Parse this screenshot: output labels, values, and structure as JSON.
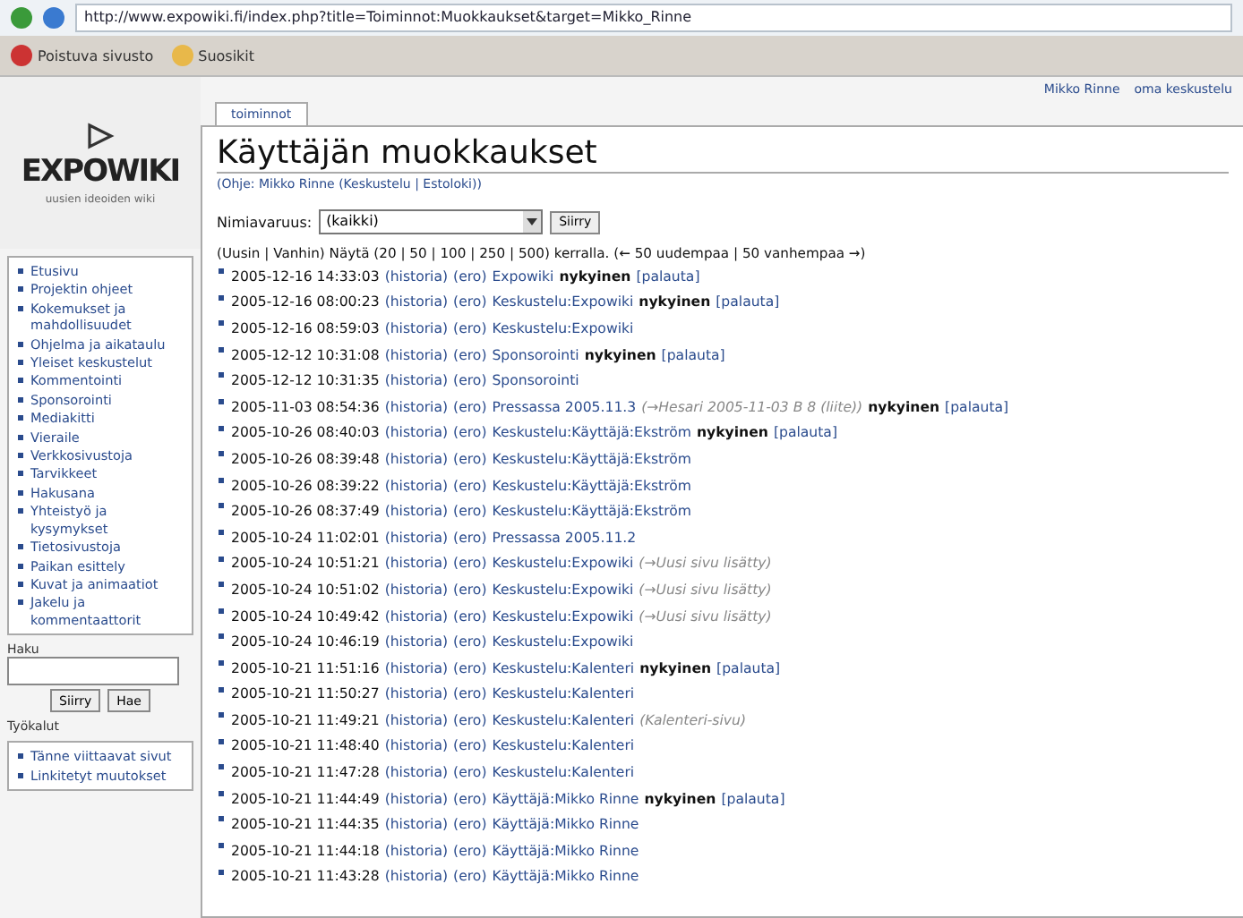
{
  "browser": {
    "url": "http://www.expowiki.fi/index.php?title=Toiminnot:Muokkaukset&target=Mikko_Rinne",
    "bookmarks": [
      "Poistuva sivusto",
      "Suosikit"
    ]
  },
  "user_links": [
    "Mikko Rinne",
    "oma keskustelu"
  ],
  "logo": {
    "name": "EXPOWIKI",
    "tagline": "uusien ideoiden wiki"
  },
  "sidebar": {
    "items": [
      "Etusivu",
      "Projektin ohjeet",
      "Kokemukset ja mahdollisuudet",
      "Ohjelma ja aikataulu",
      "Yleiset keskustelut",
      "Kommentointi",
      "Sponsorointi",
      "Mediakitti",
      "Vieraile",
      "Verkkosivustoja",
      "Tarvikkeet",
      "Hakusana",
      "Yhteistyö ja kysymykset",
      "Tietosivustoja",
      "Paikan esittely",
      "Kuvat ja animaatiot",
      "Jakelu ja kommentaattorit"
    ]
  },
  "search": {
    "heading": "Haku",
    "buttons": [
      "Siirry",
      "Hae"
    ]
  },
  "tools": {
    "heading": "Työkalut",
    "items": [
      "Tänne viittaavat sivut",
      "Linkitetyt muutokset"
    ]
  },
  "tab": "toiminnot",
  "title": "Käyttäjän muokkaukset",
  "subtitle": "(Ohje: Mikko Rinne (Keskustelu | Estoloki))",
  "filter": {
    "label": "Nimiavaruus:",
    "value": "(kaikki)",
    "button": "Siirry"
  },
  "nav": "(Uusin | Vanhin) Näytä (20 | 50 | 100 | 250 | 500) kerralla. (← 50 uudempaa | 50 vanhempaa →)",
  "rows": [
    {
      "time": "2005-12-16 14:33:03",
      "hist": "(historia)",
      "diff": "(ero)",
      "title": "Expowiki",
      "top": "nykyinen",
      "rollback": "[palauta]"
    },
    {
      "time": "2005-12-16 08:00:23",
      "hist": "(historia)",
      "diff": "(ero)",
      "title": "Keskustelu:Expowiki",
      "top": "nykyinen",
      "rollback": "[palauta]"
    },
    {
      "time": "2005-12-16 08:59:03",
      "hist": "(historia)",
      "diff": "(ero)",
      "title": "Keskustelu:Expowiki"
    },
    {
      "time": "2005-12-12 10:31:08",
      "hist": "(historia)",
      "diff": "(ero)",
      "title": "Sponsorointi",
      "top": "nykyinen",
      "rollback": "[palauta]"
    },
    {
      "time": "2005-12-12 10:31:35",
      "hist": "(historia)",
      "diff": "(ero)",
      "title": "Sponsorointi"
    },
    {
      "time": "2005-11-03 08:54:36",
      "hist": "(historia)",
      "diff": "(ero)",
      "title": "Pressassa 2005.11.3",
      "comment": "(→Hesari 2005-11-03 B 8 (liite))",
      "top": "nykyinen",
      "rollback": "[palauta]"
    },
    {
      "time": "2005-10-26 08:40:03",
      "hist": "(historia)",
      "diff": "(ero)",
      "title": "Keskustelu:Käyttäjä:Ekström",
      "top": "nykyinen",
      "rollback": "[palauta]"
    },
    {
      "time": "2005-10-26 08:39:48",
      "hist": "(historia)",
      "diff": "(ero)",
      "title": "Keskustelu:Käyttäjä:Ekström"
    },
    {
      "time": "2005-10-26 08:39:22",
      "hist": "(historia)",
      "diff": "(ero)",
      "title": "Keskustelu:Käyttäjä:Ekström"
    },
    {
      "time": "2005-10-26 08:37:49",
      "hist": "(historia)",
      "diff": "(ero)",
      "title": "Keskustelu:Käyttäjä:Ekström"
    },
    {
      "time": "2005-10-24 11:02:01",
      "hist": "(historia)",
      "diff": "(ero)",
      "title": "Pressassa 2005.11.2"
    },
    {
      "time": "2005-10-24 10:51:21",
      "hist": "(historia)",
      "diff": "(ero)",
      "title": "Keskustelu:Expowiki",
      "comment": "(→Uusi sivu lisätty)"
    },
    {
      "time": "2005-10-24 10:51:02",
      "hist": "(historia)",
      "diff": "(ero)",
      "title": "Keskustelu:Expowiki",
      "comment": "(→Uusi sivu lisätty)"
    },
    {
      "time": "2005-10-24 10:49:42",
      "hist": "(historia)",
      "diff": "(ero)",
      "title": "Keskustelu:Expowiki",
      "comment": "(→Uusi sivu lisätty)"
    },
    {
      "time": "2005-10-24 10:46:19",
      "hist": "(historia)",
      "diff": "(ero)",
      "title": "Keskustelu:Expowiki"
    },
    {
      "time": "2005-10-21 11:51:16",
      "hist": "(historia)",
      "diff": "(ero)",
      "title": "Keskustelu:Kalenteri",
      "top": "nykyinen",
      "rollback": "[palauta]"
    },
    {
      "time": "2005-10-21 11:50:27",
      "hist": "(historia)",
      "diff": "(ero)",
      "title": "Keskustelu:Kalenteri"
    },
    {
      "time": "2005-10-21 11:49:21",
      "hist": "(historia)",
      "diff": "(ero)",
      "title": "Keskustelu:Kalenteri",
      "comment": "(Kalenteri-sivu)"
    },
    {
      "time": "2005-10-21 11:48:40",
      "hist": "(historia)",
      "diff": "(ero)",
      "title": "Keskustelu:Kalenteri"
    },
    {
      "time": "2005-10-21 11:47:28",
      "hist": "(historia)",
      "diff": "(ero)",
      "title": "Keskustelu:Kalenteri"
    },
    {
      "time": "2005-10-21 11:44:49",
      "hist": "(historia)",
      "diff": "(ero)",
      "title": "Käyttäjä:Mikko Rinne",
      "top": "nykyinen",
      "rollback": "[palauta]"
    },
    {
      "time": "2005-10-21 11:44:35",
      "hist": "(historia)",
      "diff": "(ero)",
      "title": "Käyttäjä:Mikko Rinne"
    },
    {
      "time": "2005-10-21 11:44:18",
      "hist": "(historia)",
      "diff": "(ero)",
      "title": "Käyttäjä:Mikko Rinne"
    },
    {
      "time": "2005-10-21 11:43:28",
      "hist": "(historia)",
      "diff": "(ero)",
      "title": "Käyttäjä:Mikko Rinne"
    }
  ]
}
